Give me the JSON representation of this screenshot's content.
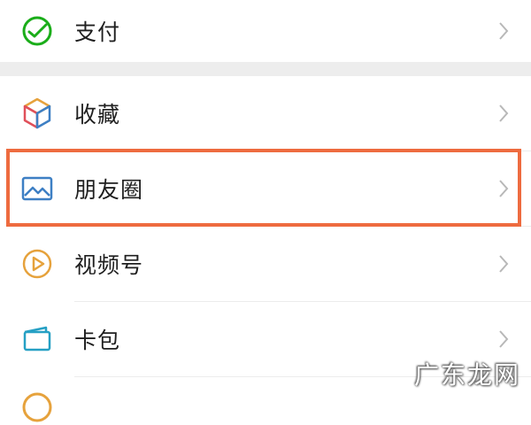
{
  "menu": {
    "items": [
      {
        "label": "支付",
        "icon": "wechat-pay-icon"
      },
      {
        "label": "收藏",
        "icon": "favorites-cube-icon"
      },
      {
        "label": "朋友圈",
        "icon": "moments-image-icon"
      },
      {
        "label": "视频号",
        "icon": "channels-play-icon"
      },
      {
        "label": "卡包",
        "icon": "card-wallet-icon"
      }
    ]
  },
  "highlighted_item": "朋友圈",
  "watermark": "广东龙网",
  "colors": {
    "highlight_border": "#ee6b3f",
    "pay_green": "#1aad19",
    "moments_blue": "#3d7fc4",
    "channels_orange": "#e6a23c",
    "card_teal": "#26a0c4"
  }
}
